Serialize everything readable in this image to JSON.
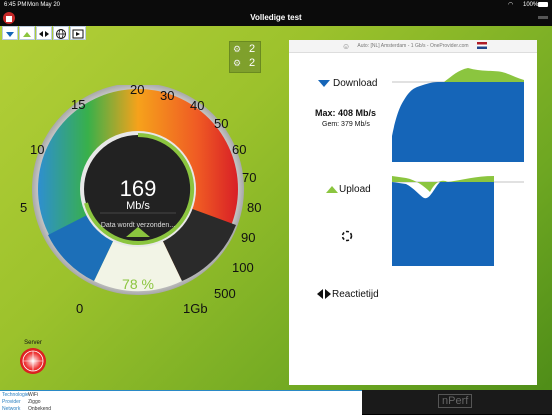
{
  "status": {
    "time": "6:45 PM",
    "date": "Mon May 20",
    "battery": "100%"
  },
  "title": "Volledige test",
  "counters": {
    "top": "2",
    "bottom": "2"
  },
  "gauge": {
    "value": "169",
    "unit": "Mb/s",
    "status_text": "Data wordt verzonden...",
    "percent": "78 %",
    "ticks": [
      "0",
      "5",
      "10",
      "15",
      "20",
      "30",
      "40",
      "50",
      "60",
      "70",
      "80",
      "90",
      "100",
      "500",
      "1Gb"
    ]
  },
  "server_label": "Server",
  "results": {
    "header": "Auto: [NL] Amsterdam - 1 Gb/s - OneProvider.com",
    "download_label": "Download",
    "max_text": "Max: 408 Mb/s",
    "avg_text": "Gem: 379 Mb/s",
    "upload_label": "Upload",
    "latency_label": "Reactietijd"
  },
  "info": [
    {
      "key": "Technologie",
      "value": "WiFi"
    },
    {
      "key": "Provider",
      "value": "Ziggo"
    },
    {
      "key": "Network",
      "value": "Onbekend"
    }
  ],
  "brand": "nPerf",
  "colors": {
    "accent_blue": "#1565b8",
    "accent_green": "#8bc53f"
  }
}
